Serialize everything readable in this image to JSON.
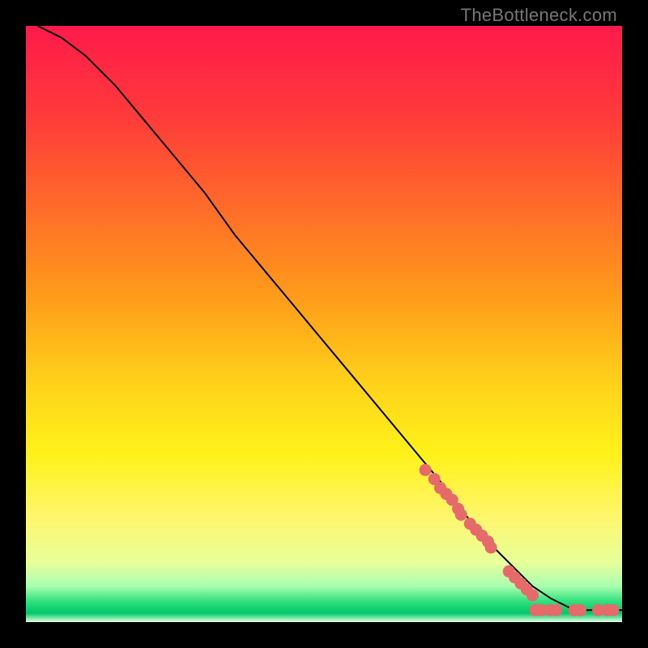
{
  "watermark": "TheBottleneck.com",
  "chart_data": {
    "type": "line",
    "title": "",
    "xlabel": "",
    "ylabel": "",
    "xlim": [
      0,
      100
    ],
    "ylim": [
      0,
      100
    ],
    "grid": false,
    "legend": false,
    "background": {
      "type": "vertical-gradient",
      "stops": [
        {
          "pos": 0.0,
          "color": "#ff1a4b"
        },
        {
          "pos": 0.15,
          "color": "#ff3a3a"
        },
        {
          "pos": 0.3,
          "color": "#ff6a2a"
        },
        {
          "pos": 0.45,
          "color": "#ff9a1a"
        },
        {
          "pos": 0.6,
          "color": "#ffd21a"
        },
        {
          "pos": 0.72,
          "color": "#fff21a"
        },
        {
          "pos": 0.82,
          "color": "#fff66a"
        },
        {
          "pos": 0.9,
          "color": "#e8ff9a"
        },
        {
          "pos": 0.94,
          "color": "#a8ffb0"
        },
        {
          "pos": 0.965,
          "color": "#32e07e"
        },
        {
          "pos": 0.985,
          "color": "#00c86a"
        },
        {
          "pos": 1.0,
          "color": "#e4ffe0"
        }
      ]
    },
    "series": [
      {
        "name": "curve",
        "type": "line",
        "color": "#000000",
        "x": [
          2,
          6,
          10,
          15,
          20,
          25,
          30,
          35,
          40,
          45,
          50,
          55,
          60,
          65,
          70,
          73,
          76,
          79,
          82,
          85,
          88,
          91,
          94,
          97,
          100
        ],
        "y": [
          100,
          98,
          95,
          90,
          84,
          78,
          72,
          65,
          59,
          53,
          47,
          41,
          35,
          29,
          23,
          19,
          15,
          12,
          9,
          6,
          4,
          2.5,
          2,
          2,
          2
        ]
      },
      {
        "name": "markers",
        "type": "scatter",
        "color": "#e76a6a",
        "x": [
          67,
          68.5,
          69.5,
          70.5,
          71.5,
          72.5,
          73,
          74.5,
          75.5,
          76.5,
          77.5,
          78,
          81,
          82,
          83,
          84,
          85,
          85.5,
          86.5,
          88,
          89,
          92,
          93,
          96,
          97.5,
          98.5
        ],
        "y": [
          25.5,
          24,
          22.5,
          21.5,
          20.5,
          19,
          18,
          16.5,
          15.5,
          14.5,
          13.5,
          12.5,
          8.5,
          7.5,
          6.5,
          5.5,
          4.5,
          2,
          2,
          2,
          2,
          2,
          2,
          2,
          2,
          2
        ]
      }
    ]
  }
}
